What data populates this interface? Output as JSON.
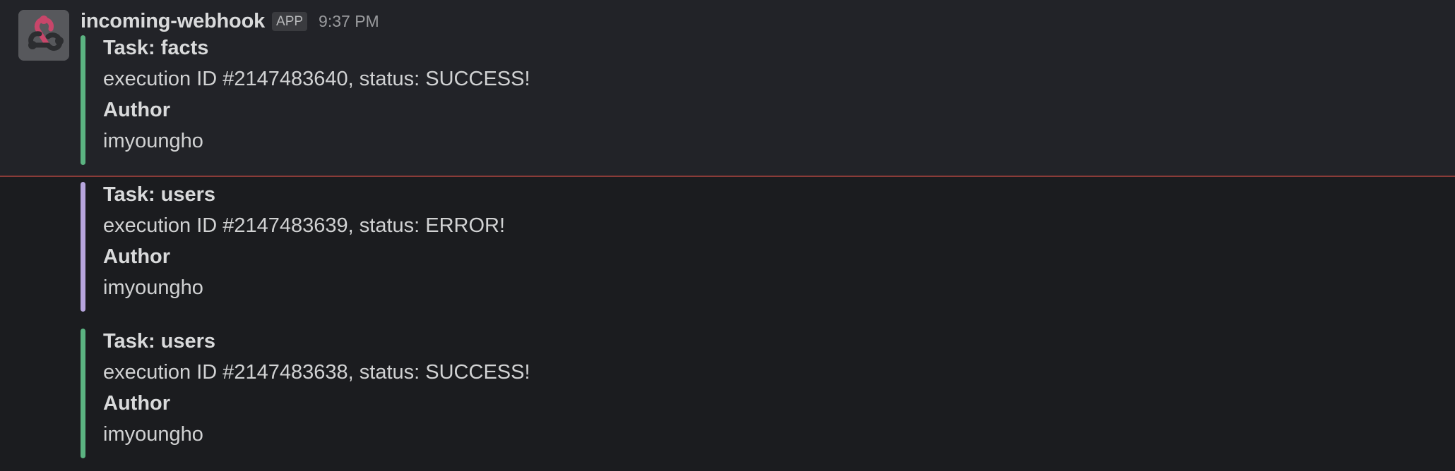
{
  "message": {
    "sender": "incoming-webhook",
    "badge": "APP",
    "time": "9:37 PM",
    "avatar_icon": "webhook-icon"
  },
  "colors": {
    "success": "#5bb381",
    "error": "#b7a5dd",
    "divider": "#8a3b38"
  },
  "attachments": [
    {
      "status": "success",
      "title": "Task: facts",
      "text": "execution ID #2147483640, status: SUCCESS!",
      "field_title": "Author",
      "field_value": "imyoungho"
    },
    {
      "status": "error",
      "title": "Task: users",
      "text": "execution ID #2147483639, status: ERROR!",
      "field_title": "Author",
      "field_value": "imyoungho"
    },
    {
      "status": "success",
      "title": "Task: users",
      "text": "execution ID #2147483638, status: SUCCESS!",
      "field_title": "Author",
      "field_value": "imyoungho"
    }
  ]
}
